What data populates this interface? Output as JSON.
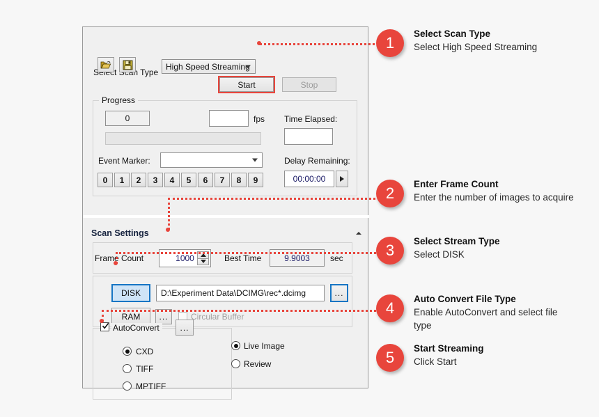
{
  "app": {
    "scan_type": {
      "label": "Select Scan Type",
      "value": "High Speed Streaming"
    },
    "toolbar": {
      "open_icon": "open-folder-icon",
      "save_icon": "save-disk-icon"
    },
    "controls": {
      "start_label": "Start",
      "stop_label": "Stop"
    },
    "progress": {
      "legend": "Progress",
      "frame_count_value": "0",
      "fps_value": "",
      "fps_label": "fps",
      "time_elapsed_label": "Time Elapsed:",
      "time_elapsed_value": "",
      "progress_percent": 0,
      "event_marker_label": "Event Marker:",
      "event_marker_value": "",
      "marker_buttons": [
        "0",
        "1",
        "2",
        "3",
        "4",
        "5",
        "6",
        "7",
        "8",
        "9"
      ],
      "delay_remaining_label": "Delay Remaining:",
      "delay_remaining_value": "00:00:00",
      "delay_play_icon": "play-icon"
    },
    "scan_settings": {
      "header": "Scan Settings",
      "collapse_icon": "chevron-up-icon",
      "frame_count_label": "Frame Count",
      "frame_count_value": "1000",
      "best_time_label": "Best Time",
      "best_time_value": "9.9003",
      "best_time_unit": "sec",
      "disk_label": "DISK",
      "disk_path": "D:\\Experiment Data\\DCIMG\\rec*.dcimg",
      "disk_browse_label": "...",
      "ram_label": "RAM",
      "ram_browse_label": "...",
      "circular_buffer_label": "Circular Buffer",
      "circular_buffer_checked": false
    },
    "autoconvert": {
      "label": "AutoConvert",
      "checked": true,
      "options_label": "...",
      "file_types": [
        {
          "label": "CXD",
          "selected": true
        },
        {
          "label": "TIFF",
          "selected": false
        },
        {
          "label": "MPTIFF",
          "selected": false
        }
      ],
      "display_modes": [
        {
          "label": "Live Image",
          "selected": true
        },
        {
          "label": "Review",
          "selected": false
        }
      ]
    }
  },
  "callouts": [
    {
      "number": "1",
      "title": "Select Scan Type",
      "body": "Select High Speed Streaming"
    },
    {
      "number": "2",
      "title": "Enter Frame Count",
      "body": "Enter the number of images to acquire"
    },
    {
      "number": "3",
      "title": "Select Stream Type",
      "body": "Select DISK"
    },
    {
      "number": "4",
      "title": "Auto Convert File Type",
      "body": "Enable AutoConvert and select file type"
    },
    {
      "number": "5",
      "title": "Start Streaming",
      "body": "Click Start"
    }
  ],
  "colors": {
    "accent_red": "#e8453c",
    "selected_blue": "#1675c4",
    "header_navy": "#14213d",
    "page_background": "#f7f7f7"
  }
}
